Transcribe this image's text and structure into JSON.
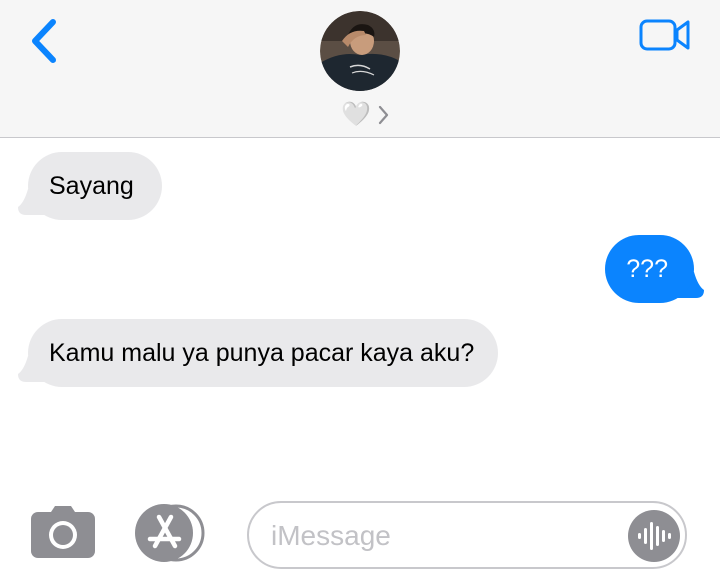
{
  "header": {
    "contact_name": "🤍",
    "icons": {
      "back": "chevron-left-icon",
      "video": "video-camera-icon",
      "contact_chevron": "chevron-right-icon"
    }
  },
  "messages": [
    {
      "direction": "received",
      "text": "Sayang"
    },
    {
      "direction": "sent",
      "text": "???"
    },
    {
      "direction": "received",
      "text": "Kamu malu ya punya pacar kaya aku?"
    }
  ],
  "composer": {
    "placeholder": "iMessage",
    "value": "",
    "icons": {
      "camera": "camera-icon",
      "apps": "app-store-icon",
      "audio": "audio-waveform-icon"
    }
  },
  "colors": {
    "accent": "#0b84fe",
    "received_bubble": "#e9e9eb",
    "header_bg": "#f6f6f6",
    "icon_gray": "#8e8e93"
  }
}
